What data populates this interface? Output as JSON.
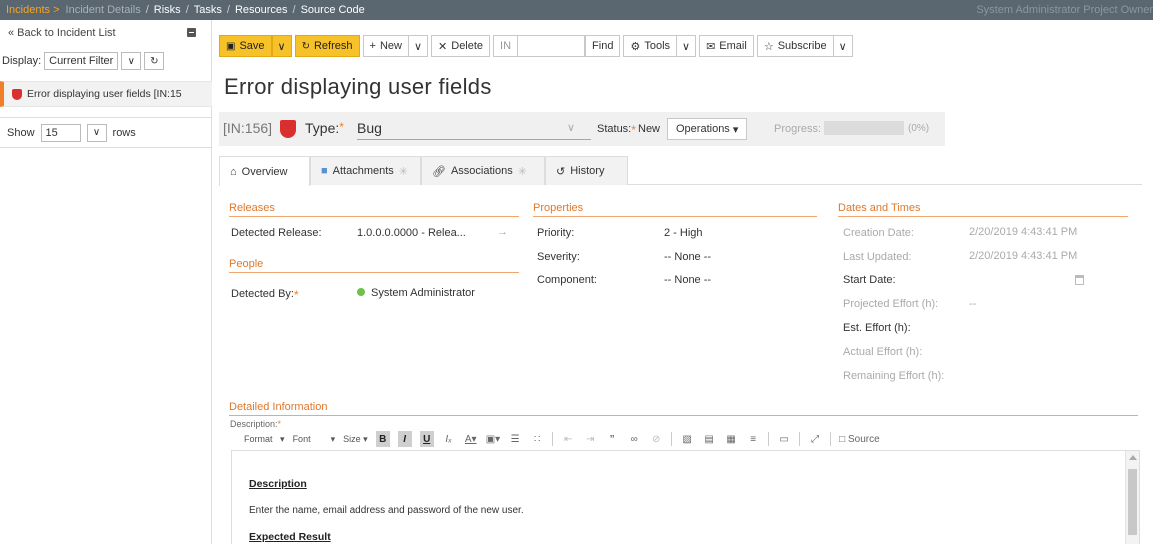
{
  "nav": {
    "items": [
      "Incidents >",
      "Incident Details",
      "Risks",
      "Tasks",
      "Resources",
      "Source Code"
    ],
    "user": "System Administrator  Project Owner"
  },
  "sidebar": {
    "back_label": "« Back to Incident List",
    "display_label": "Display:",
    "filter_value": "Current Filter",
    "incident_item": "Error displaying user fields [IN:15",
    "show_label": "Show",
    "rows_value": "15",
    "rows_label": "rows"
  },
  "toolbar": {
    "save": "Save",
    "refresh": "Refresh",
    "new": "New",
    "delete": "Delete",
    "in_label": "IN",
    "find": "Find",
    "tools": "Tools",
    "email": "Email",
    "subscribe": "Subscribe"
  },
  "incident": {
    "title": "Error displaying user fields",
    "id": "[IN:156]",
    "type_label": "Type:",
    "type_value": "Bug",
    "status_label": "Status:",
    "status_value": "New",
    "operations": "Operations",
    "progress_label": "Progress:",
    "progress_text": "(0%)",
    "progress_value": 0
  },
  "tabs": [
    "Overview",
    "Attachments",
    "Associations",
    "History"
  ],
  "releases": {
    "header": "Releases",
    "detected_release_label": "Detected Release:",
    "detected_release_value": "1.0.0.0.0000 - Relea..."
  },
  "people": {
    "header": "People",
    "detected_by_label": "Detected By:",
    "detected_by_value": "System Administrator"
  },
  "properties": {
    "header": "Properties",
    "priority_label": "Priority:",
    "priority_value": "2 - High",
    "severity_label": "Severity:",
    "severity_value": "-- None --",
    "component_label": "Component:",
    "component_value": "-- None --"
  },
  "dates": {
    "header": "Dates and Times",
    "creation_label": "Creation Date:",
    "creation_value": "2/20/2019 4:43:41 PM",
    "updated_label": "Last Updated:",
    "updated_value": "2/20/2019 4:43:41 PM",
    "start_label": "Start Date:",
    "projected_label": "Projected Effort (h):",
    "projected_value": "--",
    "est_label": "Est. Effort (h):",
    "actual_label": "Actual Effort (h):",
    "remaining_label": "Remaining Effort (h):"
  },
  "detail": {
    "header": "Detailed Information",
    "description_label": "Description:",
    "format": "Format",
    "font": "Font",
    "size": "Size",
    "source": "Source",
    "heading1": "Description",
    "body1": "Enter the name, email address and password of the new user.",
    "heading2": "Expected Result"
  },
  "colors": {
    "accent": "#f07f29",
    "toolbar_yellow": "#f7c229",
    "nav_bg": "#5a6670",
    "status_green": "#6cc24a",
    "incident_red": "#d9302f"
  }
}
